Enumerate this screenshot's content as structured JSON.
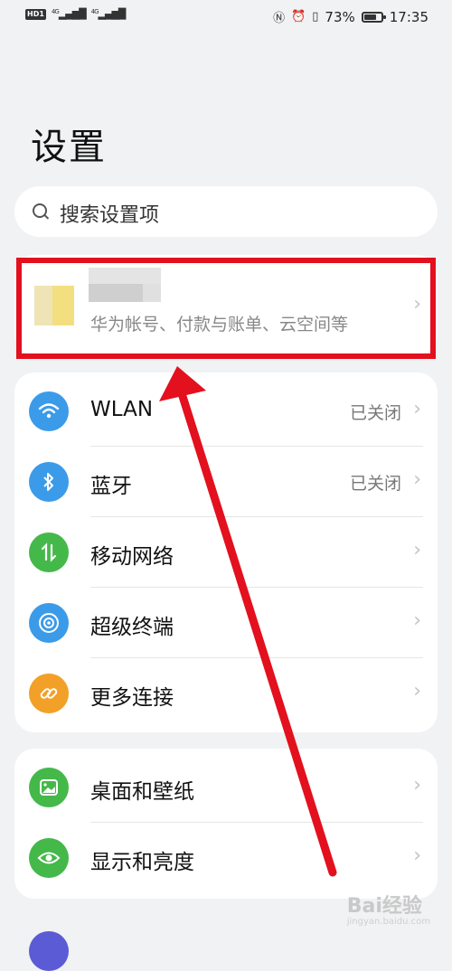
{
  "status_bar": {
    "hd_label": "HD",
    "sim1": "1",
    "net1": "4G",
    "net2": "4G",
    "battery_percent": "73%",
    "battery_level": 0.73,
    "time": "17:35",
    "icons": [
      "nfc-icon",
      "alarm-icon",
      "vibrate-icon",
      "battery-icon"
    ]
  },
  "header": {
    "title": "设置"
  },
  "search": {
    "placeholder": "搜索设置项"
  },
  "account": {
    "subtitle": "华为帐号、付款与账单、云空间等"
  },
  "groups": [
    {
      "items": [
        {
          "icon": "wifi-icon",
          "color": "#3b9be8",
          "label": "WLAN",
          "value": "已关闭"
        },
        {
          "icon": "bluetooth-icon",
          "color": "#3b9be8",
          "label": "蓝牙",
          "value": "已关闭"
        },
        {
          "icon": "mobile-network-icon",
          "color": "#45b84a",
          "label": "移动网络",
          "value": ""
        },
        {
          "icon": "super-terminal-icon",
          "color": "#3b9be8",
          "label": "超级终端",
          "value": ""
        },
        {
          "icon": "link-icon",
          "color": "#f2a028",
          "label": "更多连接",
          "value": ""
        }
      ]
    },
    {
      "items": [
        {
          "icon": "wallpaper-icon",
          "color": "#45b84a",
          "label": "桌面和壁纸",
          "value": ""
        },
        {
          "icon": "eye-icon",
          "color": "#45b84a",
          "label": "显示和亮度",
          "value": ""
        }
      ]
    }
  ],
  "annotation": {
    "highlight_color": "#e3101e"
  },
  "watermark": {
    "brand": "Bai经验",
    "url": "jingyan.baidu.com"
  }
}
